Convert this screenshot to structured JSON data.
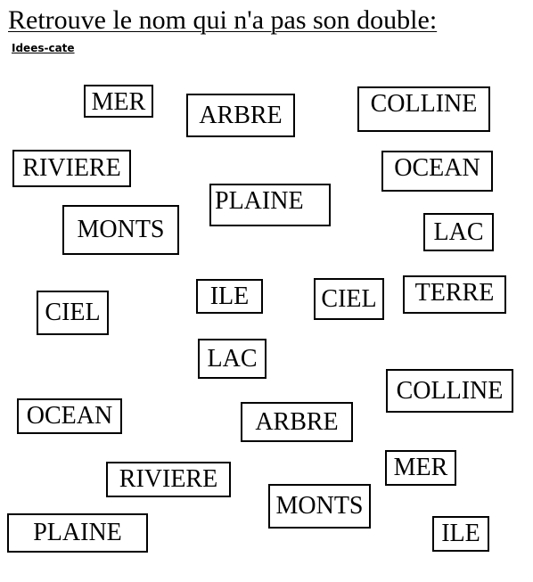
{
  "header": {
    "title": "Retrouve le nom qui n'a pas son double:",
    "subtitle": "Idees-cate"
  },
  "words": [
    "MER",
    "ARBRE",
    "COLLINE",
    "RIVIERE",
    "OCEAN",
    "PLAINE",
    "MONTS",
    "LAC",
    "ILE",
    "CIEL",
    "TERRE",
    "CIEL",
    "LAC",
    "COLLINE",
    "OCEAN",
    "ARBRE",
    "MER",
    "RIVIERE",
    "MONTS",
    "PLAINE",
    "ILE"
  ]
}
